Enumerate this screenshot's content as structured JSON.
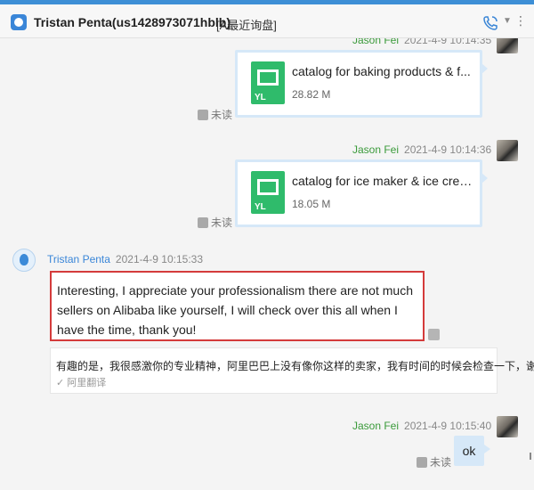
{
  "header": {
    "contact_name": "Tristan Penta(us1428973071hblb)",
    "tag": "[A最近询盘]",
    "accent": "#3d8fd6"
  },
  "messages": [
    {
      "kind": "file",
      "sender": "Jason Fei",
      "time": "2021-4-9 10:14:35",
      "file_name": "catalog for baking products & f...",
      "file_size": "28.82 M",
      "file_label": "YL",
      "status": "未读"
    },
    {
      "kind": "file",
      "sender": "Jason Fei",
      "time": "2021-4-9 10:14:36",
      "file_name": "catalog for ice maker & ice crea...",
      "file_size": "18.05 M",
      "file_label": "YL",
      "status": "未读"
    },
    {
      "kind": "text",
      "sender": "Tristan Penta",
      "time": "2021-4-9 10:15:33",
      "text": "Interesting, I appreciate your professionalism there are not much sellers on Alibaba like yourself, I will check over this all when I have the time, thank you!",
      "translation": "有趣的是，我很感激你的专业精神，阿里巴巴上没有像你这样的卖家，我有时间的时候会检查一下，谢谢!",
      "translation_source": "✓ 阿里翻译"
    },
    {
      "kind": "text",
      "sender": "Jason Fei",
      "time": "2021-4-9 10:15:40",
      "text": "ok",
      "status": "未读"
    }
  ],
  "icons": {
    "header_logo": "chat-app-icon",
    "call": "phone-icon",
    "menu": "chevron-down-icon"
  }
}
